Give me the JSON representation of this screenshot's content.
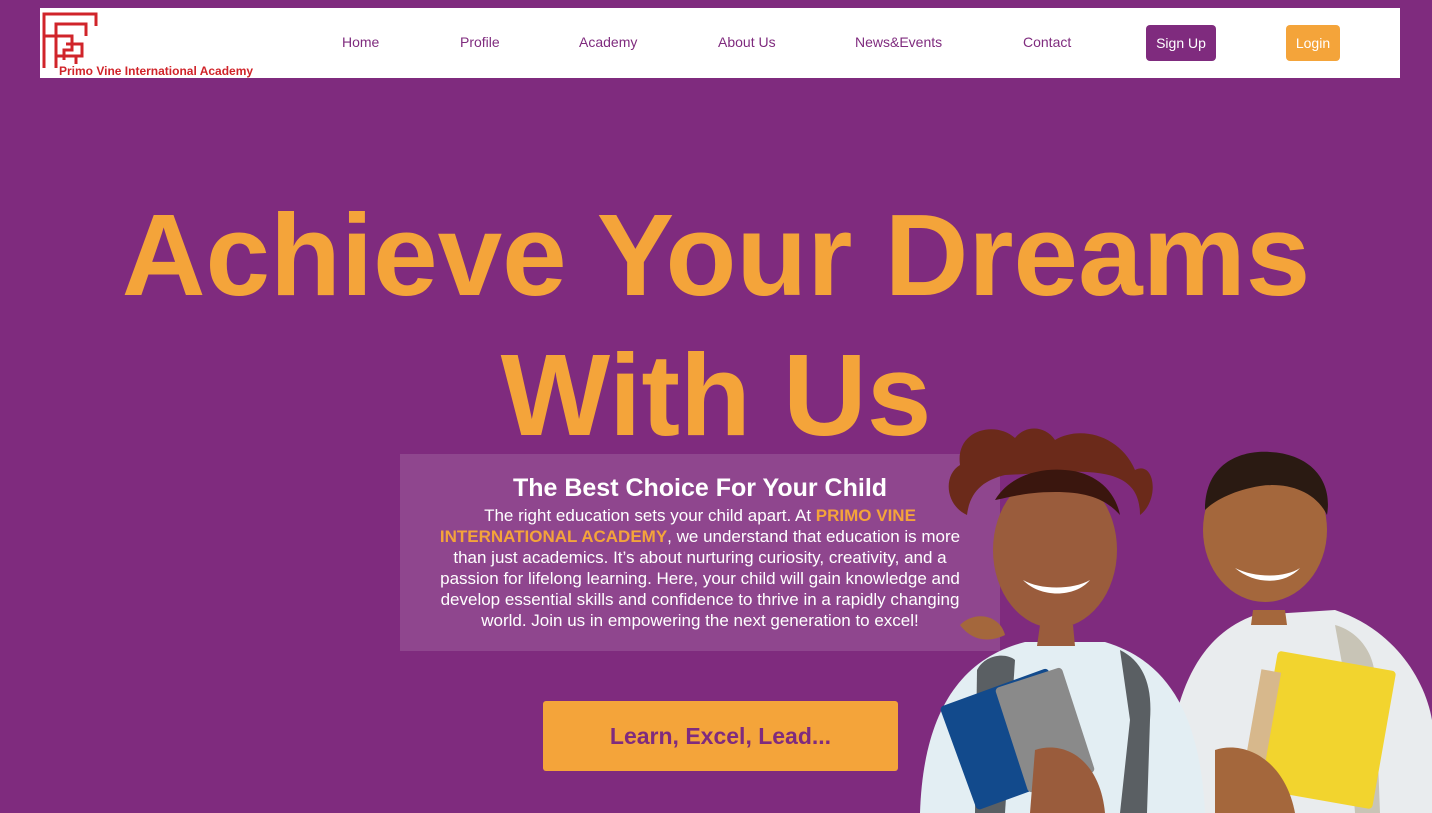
{
  "brand": {
    "name": "Primo Vine International Academy",
    "logo_color": "#d0242a"
  },
  "nav": {
    "links": [
      "Home",
      "Profile",
      "Academy",
      "About Us",
      "News&Events",
      "Contact"
    ],
    "signup_label": "Sign Up",
    "login_label": "Login"
  },
  "hero": {
    "title_line1": "Achieve Your Dreams",
    "title_line2": "With Us",
    "subtitle": "The Best Choice For Your Child",
    "body_pre": "The right education sets your child apart. At ",
    "body_highlight": "PRIMO VINE INTERNATIONAL ACADEMY",
    "body_post": ", we understand that education is more than just academics. It’s about nurturing curiosity, creativity, and a passion for lifelong learning. Here, your child will gain knowledge and develop essential skills and confidence to thrive in a rapidly changing world. Join us in empowering the next generation to excel!",
    "cta_label": "Learn, Excel, Lead..."
  },
  "colors": {
    "background": "#7f2b7e",
    "accent": "#f4a43a",
    "white": "#ffffff"
  },
  "image": {
    "icon": "students-photo"
  }
}
